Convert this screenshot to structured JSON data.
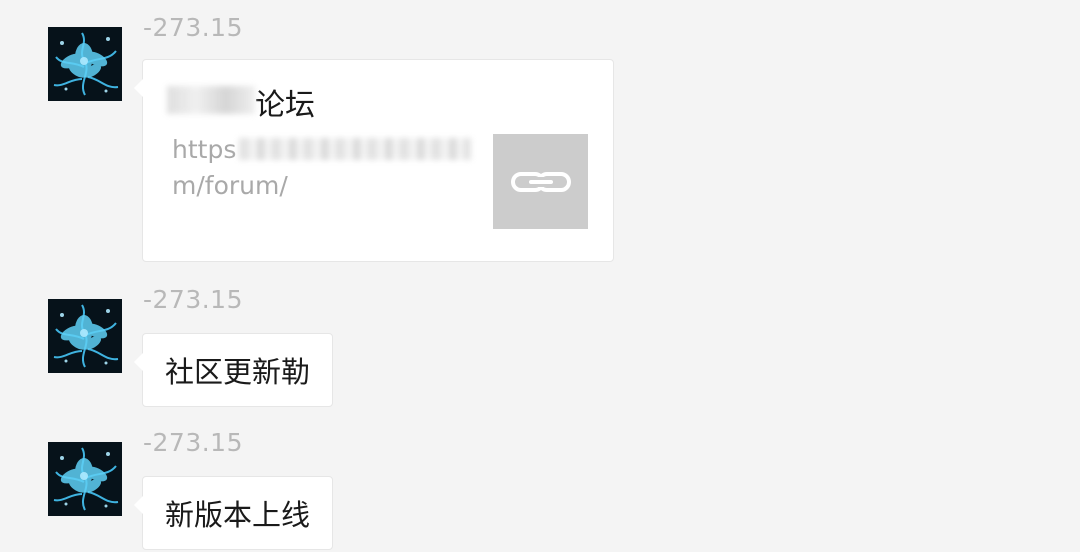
{
  "messages": [
    {
      "sender": "-273.15",
      "type": "link",
      "title": "论坛",
      "url_start": "https",
      "url_end": "m/forum/",
      "thumbnail_icon": "link-icon"
    },
    {
      "sender": "-273.15",
      "type": "text",
      "text": "社区更新勒"
    },
    {
      "sender": "-273.15",
      "type": "text",
      "text": "新版本上线"
    }
  ],
  "avatar_icon": "blue-flower-avatar",
  "colors": {
    "background": "#f4f4f4",
    "bubble": "#ffffff",
    "sender_name": "#b8b8b8",
    "link_url": "#a9a9a9",
    "thumbnail": "#cccccc"
  }
}
